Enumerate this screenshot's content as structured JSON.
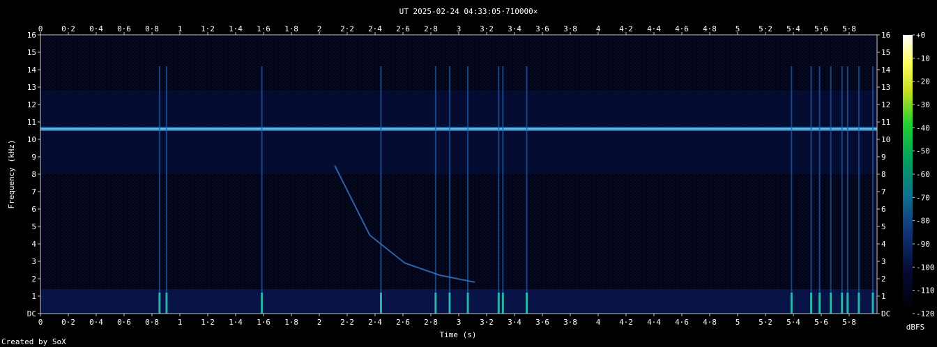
{
  "chart_data": {
    "type": "heatmap",
    "title": "UT 2025-02-24 04:33:05·710000×",
    "xlabel": "Time (s)",
    "ylabel": "Frequency (kHz)",
    "xlim": [
      0,
      5.97
    ],
    "ylim": [
      0,
      16
    ],
    "x_ticks": [
      "0",
      "0·2",
      "0·4",
      "0·6",
      "0·8",
      "1",
      "1·2",
      "1·4",
      "1·6",
      "1·8",
      "2",
      "2·2",
      "2·4",
      "2·6",
      "2·8",
      "3",
      "3·2",
      "3·4",
      "3·6",
      "3·8",
      "4",
      "4·2",
      "4·4",
      "4·6",
      "4·8",
      "5",
      "5·2",
      "5·4",
      "5·6",
      "5·8"
    ],
    "y_ticks": [
      "DC",
      "1",
      "2",
      "3",
      "4",
      "5",
      "6",
      "7",
      "8",
      "9",
      "10",
      "11",
      "12",
      "13",
      "14",
      "15",
      "16"
    ],
    "colorbar": {
      "label": "dBFS",
      "ticks": [
        "+0",
        "-10",
        "-20",
        "-30",
        "-40",
        "-50",
        "-60",
        "-70",
        "-80",
        "-90",
        "-100",
        "-110",
        "-120"
      ],
      "range": [
        -120,
        0
      ]
    },
    "features": {
      "tone_khz": 10.6,
      "transients_s": [
        0.85,
        0.9,
        1.58,
        2.43,
        2.82,
        2.92,
        3.05,
        3.27,
        3.3,
        3.47,
        5.36,
        5.5,
        5.56,
        5.64,
        5.72,
        5.76,
        5.84,
        5.94
      ],
      "sweep": {
        "t": [
          2.1,
          2.35,
          2.6,
          2.85,
          3.1
        ],
        "f_khz": [
          8.5,
          4.5,
          2.9,
          2.2,
          1.8
        ]
      }
    },
    "colors": {
      "low": "#000010",
      "mid": "#1a4aa0",
      "high": "#2ec8b0",
      "top": "#ffffff"
    }
  },
  "footer": "Created by SoX"
}
